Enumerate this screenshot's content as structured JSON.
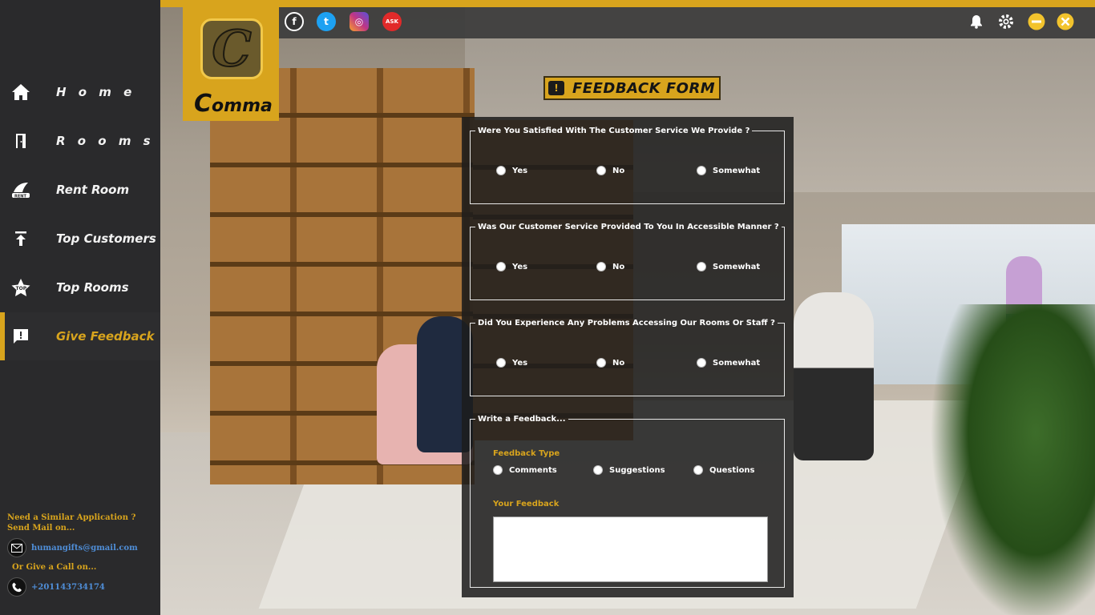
{
  "app": {
    "logo_letter": "C",
    "logo_name_first": "C",
    "logo_name_rest": "omma"
  },
  "sidebar": {
    "items": [
      {
        "label": "H o m e",
        "icon": "home-icon"
      },
      {
        "label": "R o o m s",
        "icon": "door-icon"
      },
      {
        "label": "Rent Room",
        "icon": "rent-icon"
      },
      {
        "label": "Top Customers",
        "icon": "arrow-up-icon"
      },
      {
        "label": "Top Rooms",
        "icon": "star-top-icon"
      },
      {
        "label": "Give Feedback",
        "icon": "feedback-icon"
      }
    ],
    "active_index": 5,
    "contact": {
      "line1": "Need a Similar Application ?",
      "line2": "Send Mail on...",
      "email": "humangifts@gmail.com",
      "call_line": "Or Give a Call on...",
      "phone": "+201143734174"
    }
  },
  "topbar": {
    "social": [
      {
        "name": "facebook-icon",
        "glyph": "f",
        "color": "#2b2b2b"
      },
      {
        "name": "twitter-icon",
        "glyph": "t",
        "color": "#1da1f2"
      },
      {
        "name": "instagram-icon",
        "glyph": "◎",
        "color": "#c13584"
      },
      {
        "name": "askfm-icon",
        "glyph": "ASK",
        "color": "#e12a2a"
      }
    ],
    "icons": [
      "bell-icon",
      "settings-icon",
      "minimize-icon",
      "close-icon"
    ]
  },
  "form": {
    "title": "FEEDBACK FORM",
    "q1": {
      "legend": "Were You Satisfied With The Customer Service We Provide ?",
      "options": [
        "Yes",
        "No",
        "Somewhat"
      ]
    },
    "q2": {
      "legend": "Was Our Customer Service Provided To You In Accessible Manner ?",
      "options": [
        "Yes",
        "No",
        "Somewhat"
      ]
    },
    "q3": {
      "legend": "Did You Experience Any Problems Accessing Our Rooms Or Staff ?",
      "options": [
        "Yes",
        "No",
        "Somewhat"
      ]
    },
    "write": {
      "legend": "Write a Feedback...",
      "type_label": "Feedback Type",
      "types": [
        "Comments",
        "Suggestions",
        "Questions"
      ],
      "your_feedback_label": "Your Feedback",
      "feedback_value": ""
    }
  },
  "colors": {
    "accent": "#d8a41d",
    "sidebar": "#2a2a2c",
    "link": "#4f8ed8"
  }
}
